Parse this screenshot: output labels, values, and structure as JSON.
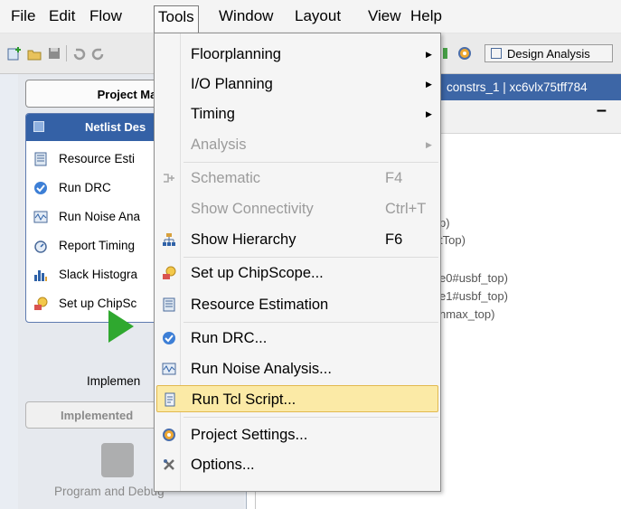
{
  "menubar": {
    "items": [
      "File",
      "Edit",
      "Flow",
      "Tools",
      "Window",
      "Layout",
      "View",
      "Help"
    ]
  },
  "toolbar": {
    "design_analysis_label": "Design Analysis"
  },
  "flow_navigator": {
    "project_manager_label": "Project Mar",
    "netlist_header": "Netlist Des",
    "items": [
      {
        "label": "Resource Esti",
        "icon": "resource-estimation-icon"
      },
      {
        "label": "Run DRC",
        "icon": "drc-check-icon"
      },
      {
        "label": "Run Noise Ana",
        "icon": "noise-analysis-icon"
      },
      {
        "label": "Report Timing",
        "icon": "timing-clock-icon"
      },
      {
        "label": "Slack Histogra",
        "icon": "slack-histogram-icon"
      },
      {
        "label": "Set up ChipSc",
        "icon": "chipscope-icon"
      }
    ],
    "implement_label": "Implemen",
    "implemented_design_label": "Implemented",
    "program_debug_label": "Program and Debug"
  },
  "source_panel": {
    "tab_text": "constrs_1 | xc6vlx75tff784",
    "lines": [
      "p)",
      "tTop)",
      "e0#usbf_top)",
      "e1#usbf_top)",
      "nmax_top)"
    ]
  },
  "tools_menu": {
    "items": [
      {
        "label": "Floorplanning",
        "shortcut": "",
        "submenu": true,
        "disabled": false,
        "icon": ""
      },
      {
        "label": "I/O Planning",
        "shortcut": "",
        "submenu": true,
        "disabled": false,
        "icon": ""
      },
      {
        "label": "Timing",
        "shortcut": "",
        "submenu": true,
        "disabled": false,
        "icon": ""
      },
      {
        "label": "Analysis",
        "shortcut": "",
        "submenu": true,
        "disabled": true,
        "icon": ""
      },
      {
        "label": "Schematic",
        "shortcut": "F4",
        "submenu": false,
        "disabled": true,
        "icon": "schematic-icon"
      },
      {
        "label": "Show Connectivity",
        "shortcut": "Ctrl+T",
        "submenu": false,
        "disabled": true,
        "icon": ""
      },
      {
        "label": "Show Hierarchy",
        "shortcut": "F6",
        "submenu": false,
        "disabled": false,
        "icon": "hierarchy-icon"
      },
      {
        "label": "Set up ChipScope...",
        "shortcut": "",
        "submenu": false,
        "disabled": false,
        "icon": "chipscope-icon"
      },
      {
        "label": "Resource Estimation",
        "shortcut": "",
        "submenu": false,
        "disabled": false,
        "icon": "resource-estimation-icon"
      },
      {
        "label": "Run DRC...",
        "shortcut": "",
        "submenu": false,
        "disabled": false,
        "icon": "drc-check-icon"
      },
      {
        "label": "Run Noise Analysis...",
        "shortcut": "",
        "submenu": false,
        "disabled": false,
        "icon": "noise-analysis-icon"
      },
      {
        "label": "Run Tcl Script...",
        "shortcut": "",
        "submenu": false,
        "disabled": false,
        "icon": "tcl-script-icon",
        "highlighted": true
      },
      {
        "label": "Project Settings...",
        "shortcut": "",
        "submenu": false,
        "disabled": false,
        "icon": "project-settings-icon"
      },
      {
        "label": "Options...",
        "shortcut": "",
        "submenu": false,
        "disabled": false,
        "icon": "options-tools-icon"
      }
    ]
  },
  "colors": {
    "header_blue": "#3461a6",
    "highlight_fill": "#fbeaa6",
    "highlight_border": "#e2b94f",
    "disabled_text": "#9b9b9b"
  }
}
